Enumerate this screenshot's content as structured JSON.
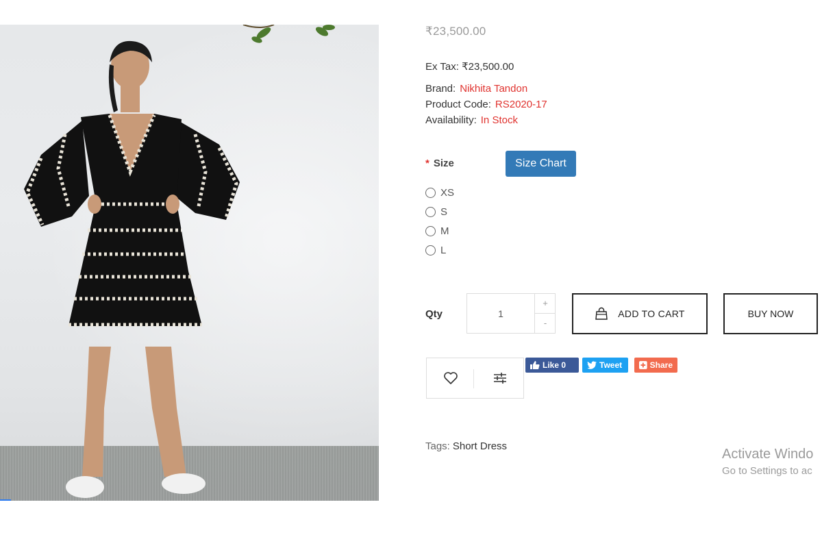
{
  "product": {
    "price": "₹23,500.00",
    "ex_tax": "Ex Tax: ₹23,500.00",
    "brand_label": "Brand:",
    "brand_value": "Nikhita Tandon",
    "code_label": "Product Code:",
    "code_value": "RS2020-17",
    "availability_label": "Availability:",
    "availability_value": "In Stock",
    "accent_color": "#e0332f"
  },
  "size": {
    "required_mark": "*",
    "label": "Size",
    "chart_button": "Size Chart",
    "options": [
      "XS",
      "S",
      "M",
      "L"
    ]
  },
  "quantity": {
    "label": "Qty",
    "value": "1",
    "plus": "+",
    "minus": "-"
  },
  "actions": {
    "add_to_cart": "ADD TO CART",
    "buy_now": "BUY NOW",
    "wishlist_icon": "heart-icon",
    "compare_icon": "sliders-icon"
  },
  "social": {
    "like": "Like 0",
    "tweet": "Tweet",
    "share": "Share"
  },
  "tags": {
    "label": "Tags:",
    "items": [
      "Short Dress"
    ]
  },
  "watermark": {
    "title": "Activate Windo",
    "subtitle": "Go to Settings to ac"
  }
}
